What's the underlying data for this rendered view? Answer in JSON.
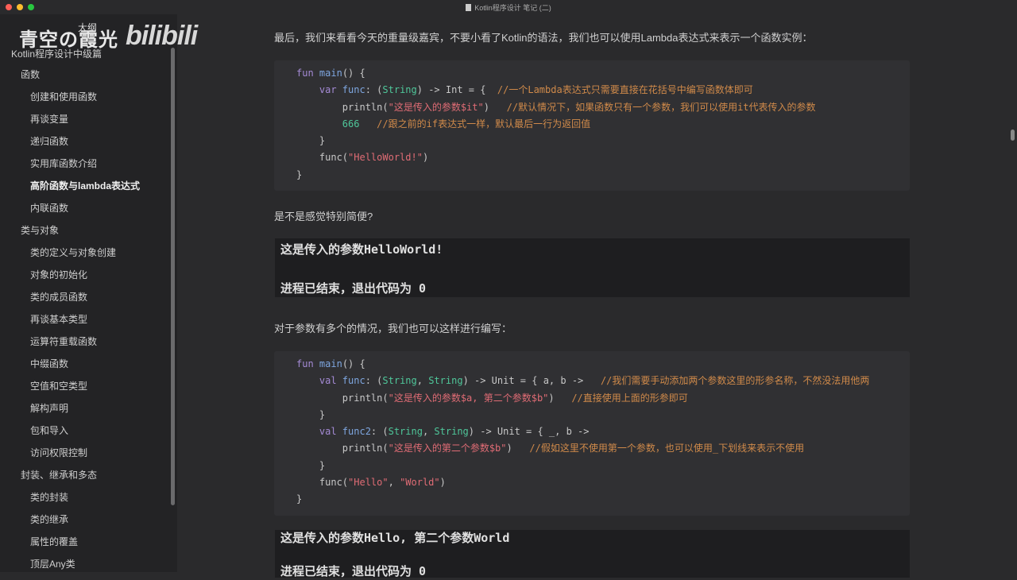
{
  "window": {
    "title": "Kotlin程序设计 笔记 (二)"
  },
  "watermark": {
    "logo": "青空の霞光",
    "logo_sub": "大纲",
    "bili": "bilibili"
  },
  "sidebar": {
    "title": "Kotlin程序设计中级篇",
    "items": [
      {
        "label": "函数",
        "level": 1
      },
      {
        "label": "创建和使用函数",
        "level": 2
      },
      {
        "label": "再谈变量",
        "level": 2
      },
      {
        "label": "递归函数",
        "level": 2
      },
      {
        "label": "实用库函数介绍",
        "level": 2
      },
      {
        "label": "高阶函数与lambda表达式",
        "level": 2,
        "active": true
      },
      {
        "label": "内联函数",
        "level": 2
      },
      {
        "label": "类与对象",
        "level": 1
      },
      {
        "label": "类的定义与对象创建",
        "level": 2
      },
      {
        "label": "对象的初始化",
        "level": 2
      },
      {
        "label": "类的成员函数",
        "level": 2
      },
      {
        "label": "再谈基本类型",
        "level": 2
      },
      {
        "label": "运算符重载函数",
        "level": 2
      },
      {
        "label": "中缀函数",
        "level": 2
      },
      {
        "label": "空值和空类型",
        "level": 2
      },
      {
        "label": "解构声明",
        "level": 2
      },
      {
        "label": "包和导入",
        "level": 2
      },
      {
        "label": "访问权限控制",
        "level": 2
      },
      {
        "label": "封装、继承和多态",
        "level": 1
      },
      {
        "label": "类的封装",
        "level": 2
      },
      {
        "label": "类的继承",
        "level": 2
      },
      {
        "label": "属性的覆盖",
        "level": 2
      },
      {
        "label": "顶层Any类",
        "level": 2
      }
    ]
  },
  "content": {
    "p1": "最后，我们来看看今天的重量级嘉宾，不要小看了Kotlin的语法，我们也可以使用Lambda表达式来表示一个函数实例：",
    "code1": [
      [
        [
          "fun ",
          "kw"
        ],
        [
          "main",
          "fn"
        ],
        [
          "() {",
          ""
        ]
      ],
      [
        [
          "    var ",
          "kw"
        ],
        [
          "func",
          "fn"
        ],
        [
          ": (",
          ""
        ],
        [
          "String",
          "ty"
        ],
        [
          ") -> Int = {  ",
          ""
        ],
        [
          "//一个Lambda表达式只需要直接在花括号中编写函数体即可",
          "cm"
        ]
      ],
      [
        [
          "        println(",
          ""
        ],
        [
          "\"这是传入的参数$it\"",
          "st"
        ],
        [
          ")   ",
          ""
        ],
        [
          "//默认情况下，如果函数只有一个参数，我们可以使用it代表传入的参数",
          "cm"
        ]
      ],
      [
        [
          "        ",
          ""
        ],
        [
          "666",
          "nu"
        ],
        [
          "   ",
          ""
        ],
        [
          "//跟之前的if表达式一样，默认最后一行为返回值",
          "cm"
        ]
      ],
      [
        [
          "    }",
          ""
        ]
      ],
      [
        [
          "    func(",
          ""
        ],
        [
          "\"HelloWorld!\"",
          "st"
        ],
        [
          ")",
          ""
        ]
      ],
      [
        [
          "}",
          ""
        ]
      ]
    ],
    "p2": "是不是感觉特别简便?",
    "out1": [
      "这是传入的参数HelloWorld!",
      "",
      "进程已结束，退出代码为 0"
    ],
    "p3": "对于参数有多个的情况，我们也可以这样进行编写：",
    "code2": [
      [
        [
          "fun ",
          "kw"
        ],
        [
          "main",
          "fn"
        ],
        [
          "() {",
          ""
        ]
      ],
      [
        [
          "    val ",
          "kw"
        ],
        [
          "func",
          "fn"
        ],
        [
          ": (",
          ""
        ],
        [
          "String",
          "ty"
        ],
        [
          ", ",
          ""
        ],
        [
          "String",
          "ty"
        ],
        [
          ") -> Unit = { a, b ->   ",
          ""
        ],
        [
          "//我们需要手动添加两个参数这里的形参名称，不然没法用他两",
          "cm"
        ]
      ],
      [
        [
          "        println(",
          ""
        ],
        [
          "\"这是传入的参数$a, 第二个参数$b\"",
          "st"
        ],
        [
          ")   ",
          ""
        ],
        [
          "//直接使用上面的形参即可",
          "cm"
        ]
      ],
      [
        [
          "    }",
          ""
        ]
      ],
      [
        [
          "    val ",
          "kw"
        ],
        [
          "func2",
          "fn"
        ],
        [
          ": (",
          ""
        ],
        [
          "String",
          "ty"
        ],
        [
          ", ",
          ""
        ],
        [
          "String",
          "ty"
        ],
        [
          ") -> Unit = { _, b ->",
          ""
        ]
      ],
      [
        [
          "        println(",
          ""
        ],
        [
          "\"这是传入的第二个参数$b\"",
          "st"
        ],
        [
          ")   ",
          ""
        ],
        [
          "//假如这里不使用第一个参数，也可以使用_下划线来表示不使用",
          "cm"
        ]
      ],
      [
        [
          "    }",
          ""
        ]
      ],
      [
        [
          "    func(",
          ""
        ],
        [
          "\"Hello\"",
          "st"
        ],
        [
          ", ",
          ""
        ],
        [
          "\"World\"",
          "st"
        ],
        [
          ")",
          ""
        ]
      ],
      [
        [
          "}",
          ""
        ]
      ]
    ],
    "out2": [
      "这是传入的参数Hello, 第二个参数World",
      "",
      "进程已结束，退出代码为 0"
    ]
  }
}
